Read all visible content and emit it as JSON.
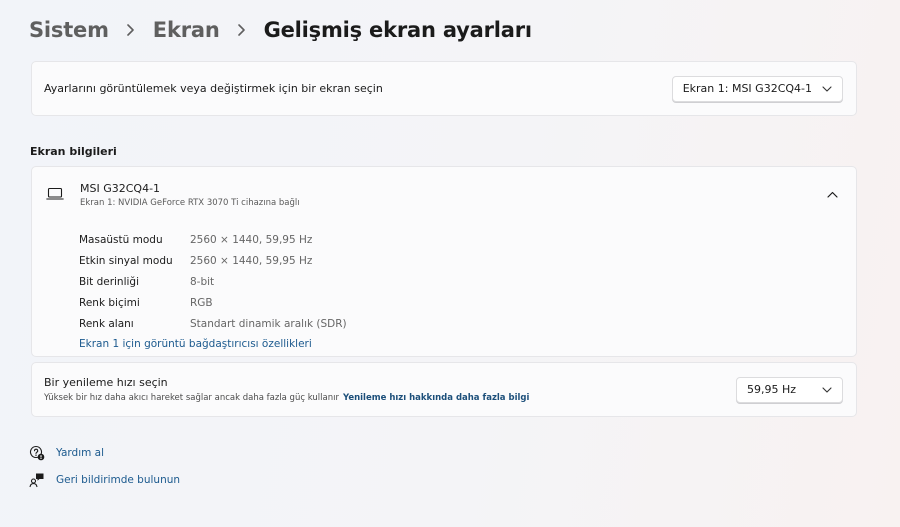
{
  "breadcrumb": {
    "items": [
      "Sistem",
      "Ekran",
      "Gelişmiş ekran ayarları"
    ]
  },
  "display_select": {
    "label": "Ayarlarını görüntülemek veya değiştirmek için bir ekran seçin",
    "selected": "Ekran 1: MSI G32CQ4-1"
  },
  "display_info": {
    "section_title": "Ekran bilgileri",
    "monitor_name": "MSI G32CQ4-1",
    "monitor_sub": "Ekran 1: NVIDIA GeForce RTX 3070 Ti cihazına bağlı",
    "rows": [
      {
        "key": "Masaüstü modu",
        "value": "2560 × 1440, 59,95 Hz"
      },
      {
        "key": "Etkin sinyal modu",
        "value": "2560 × 1440, 59,95 Hz"
      },
      {
        "key": "Bit derinliği",
        "value": "8-bit"
      },
      {
        "key": "Renk biçimi",
        "value": "RGB"
      },
      {
        "key": "Renk alanı",
        "value": "Standart dinamik aralık (SDR)"
      }
    ],
    "adapter_link": "Ekran 1 için görüntü bağdaştırıcısı özellikleri"
  },
  "refresh": {
    "title": "Bir yenileme hızı seçin",
    "description": "Yüksek bir hız daha akıcı hareket sağlar ancak daha fazla güç kullanır",
    "learn_more": "Yenileme hızı hakkında daha fazla bilgi",
    "selected": "59,95 Hz"
  },
  "footer": {
    "help": "Yardım al",
    "feedback": "Geri bildirimde bulunun"
  },
  "icons": {
    "monitor": "laptop-icon",
    "help": "help-icon",
    "feedback": "feedback-icon"
  },
  "colors": {
    "link": "#1c5a8e",
    "card_bg": "#fbfbfc",
    "border": "#e6e6e9"
  }
}
